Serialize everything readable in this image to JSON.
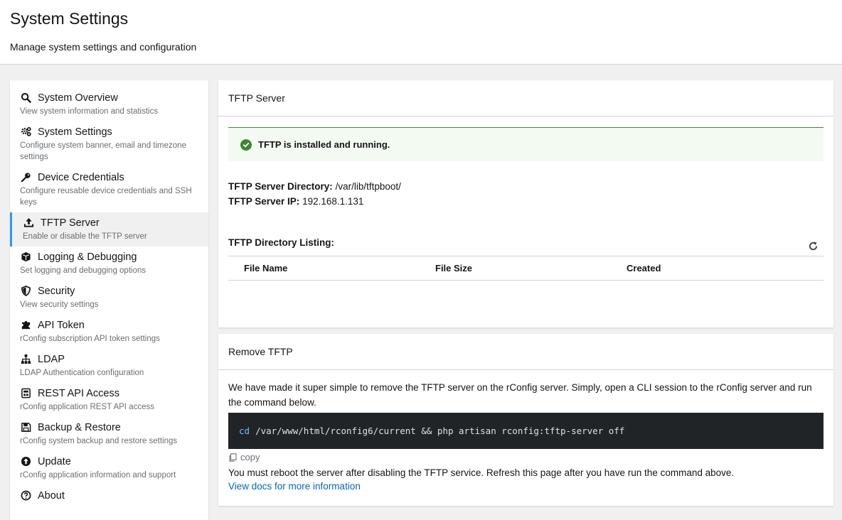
{
  "header": {
    "title": "System Settings",
    "subtitle": "Manage system settings and configuration"
  },
  "sidebar": {
    "items": [
      {
        "label": "System Overview",
        "desc": "View system information and statistics",
        "icon": "search-icon"
      },
      {
        "label": "System Settings",
        "desc": "Configure system banner, email and timezone settings",
        "icon": "gears-icon"
      },
      {
        "label": "Device Credentials",
        "desc": "Configure reusable device credentials and SSH keys",
        "icon": "key-icon"
      },
      {
        "label": "TFTP Server",
        "desc": "Enable or disable the TFTP server",
        "icon": "upload-icon",
        "active": true
      },
      {
        "label": "Logging & Debugging",
        "desc": "Set logging and debugging options",
        "icon": "cube-icon"
      },
      {
        "label": "Security",
        "desc": "View security settings",
        "icon": "shield-icon"
      },
      {
        "label": "API Token",
        "desc": "rConfig subscription API token settings",
        "icon": "puzzle-icon"
      },
      {
        "label": "LDAP",
        "desc": "LDAP Authentication configuration",
        "icon": "sitemap-icon"
      },
      {
        "label": "REST API Access",
        "desc": "rConfig application REST API access",
        "icon": "api-icon"
      },
      {
        "label": "Backup & Restore",
        "desc": "rConfig system backup and restore settings",
        "icon": "save-icon"
      },
      {
        "label": "Update",
        "desc": "rConfig application information and support",
        "icon": "arrow-up-circle-icon"
      },
      {
        "label": "About",
        "desc": "",
        "icon": "question-circle-icon"
      }
    ]
  },
  "tftp": {
    "card_title": "TFTP Server",
    "status": "TFTP is installed and running.",
    "dir_label": "TFTP Server Directory:",
    "dir_value": "/var/lib/tftpboot/",
    "ip_label": "TFTP Server IP:",
    "ip_value": "192.168.1.131",
    "listing_title": "TFTP Directory Listing:",
    "columns": [
      "File Name",
      "File Size",
      "Created"
    ],
    "rows": []
  },
  "remove": {
    "card_title": "Remove TFTP",
    "description": "We have made it super simple to remove the TFTP server on the rConfig server. Simply, open a CLI session to the rConfig server and run the command below.",
    "command_kw": "cd",
    "command_rest": "/var/www/html/rconfig6/current && php artisan rconfig:tftp-server off",
    "copy_label": "copy",
    "reboot_note": "You must reboot the server after disabling the TFTP service. Refresh this page after you have run the command above.",
    "docs_link": "View docs for more information"
  },
  "colors": {
    "accent": "#2b9af3",
    "success": "#3e8635",
    "link": "#0066cc",
    "code_bg": "#212427"
  }
}
